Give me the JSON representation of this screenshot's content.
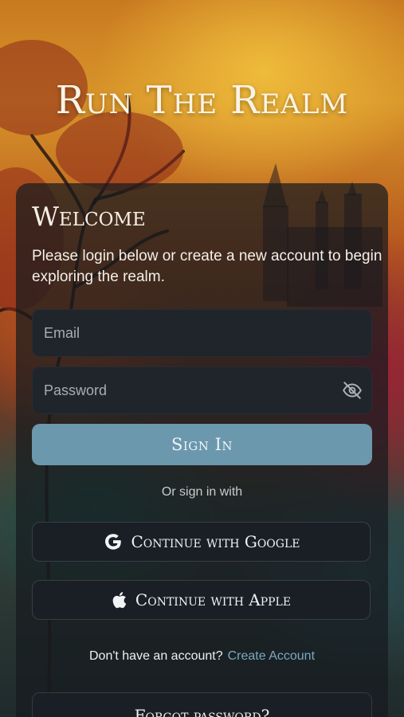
{
  "app": {
    "title": "Run The Realm"
  },
  "login": {
    "heading": "Welcome",
    "subtitle": "Please login below or create a new account to begin exploring the realm.",
    "email_placeholder": "Email",
    "password_placeholder": "Password",
    "sign_in_label": "Sign In",
    "alt_signin_text": "Or sign in with",
    "google_label": "Continue with Google",
    "apple_label": "Continue with Apple",
    "no_account_text": "Don't have an account?",
    "create_account_label": "Create Account",
    "forgot_password_label": "Forgot password?"
  },
  "icons": {
    "password_toggle": "eye-off-icon",
    "google": "google-icon",
    "apple": "apple-icon"
  },
  "colors": {
    "primary_button": "#6b98ad",
    "link": "#79a9c2",
    "field_bg": "#1f252b"
  }
}
